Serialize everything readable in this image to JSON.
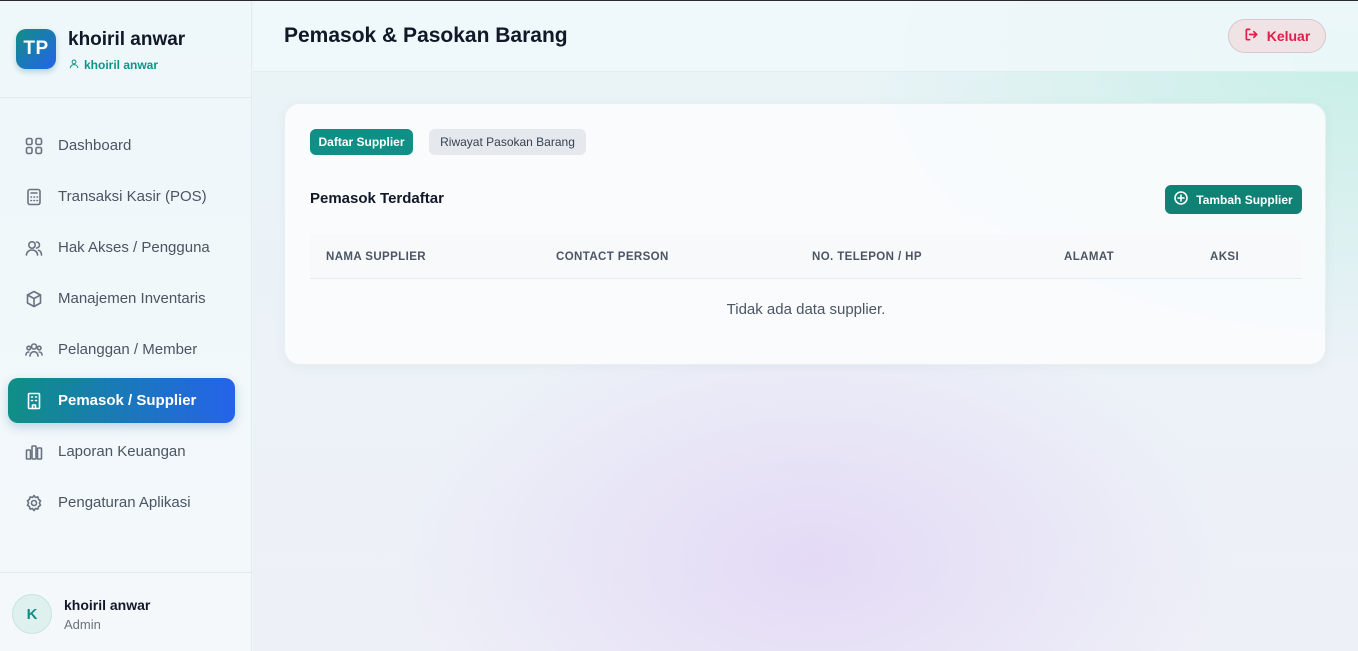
{
  "brand": {
    "logo": "TP",
    "name": "khoiril anwar",
    "username": "khoiril anwar"
  },
  "nav": [
    {
      "label": "Dashboard",
      "icon": "grid-icon"
    },
    {
      "label": "Transaksi Kasir (POS)",
      "icon": "calculator-icon"
    },
    {
      "label": "Hak Akses / Pengguna",
      "icon": "users-icon"
    },
    {
      "label": "Manajemen Inventaris",
      "icon": "box-icon"
    },
    {
      "label": "Pelanggan / Member",
      "icon": "group-icon"
    },
    {
      "label": "Pemasok / Supplier",
      "icon": "building-icon",
      "active": true
    },
    {
      "label": "Laporan Keuangan",
      "icon": "bar-chart-icon"
    },
    {
      "label": "Pengaturan Aplikasi",
      "icon": "gear-icon"
    }
  ],
  "user": {
    "initial": "K",
    "name": "khoiril anwar",
    "role": "Admin"
  },
  "header": {
    "title": "Pemasok & Pasokan Barang",
    "logout_label": "Keluar"
  },
  "tabs": [
    {
      "label": "Daftar Supplier",
      "active": true
    },
    {
      "label": "Riwayat Pasokan Barang",
      "active": false
    }
  ],
  "section": {
    "title": "Pemasok Terdaftar",
    "add_label": "Tambah Supplier"
  },
  "table": {
    "columns": [
      "NAMA SUPPLIER",
      "CONTACT PERSON",
      "NO. TELEPON / HP",
      "ALAMAT",
      "AKSI"
    ],
    "empty_text": "Tidak ada data supplier."
  },
  "colors": {
    "accent": "#0f8f85",
    "accent_blue": "#2563eb",
    "danger": "#e11d48"
  }
}
